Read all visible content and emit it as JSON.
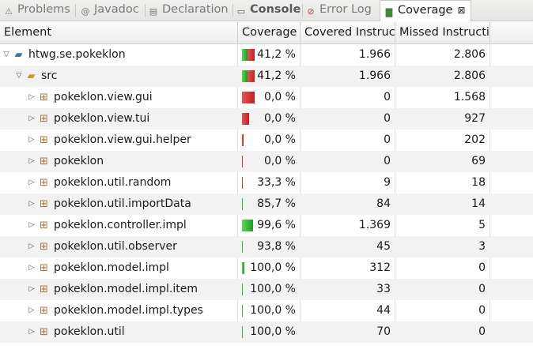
{
  "tabs": [
    {
      "label": "Problems",
      "icon": "problems-icon",
      "glyph": "⚠"
    },
    {
      "label": "Javadoc",
      "icon": "javadoc-icon",
      "glyph": "@"
    },
    {
      "label": "Declaration",
      "icon": "declaration-icon",
      "glyph": "▤"
    },
    {
      "label": "Console",
      "icon": "console-icon",
      "glyph": "▭"
    },
    {
      "label": "Error Log",
      "icon": "error-log-icon",
      "glyph": "⊘"
    },
    {
      "label": "Coverage",
      "icon": "coverage-icon",
      "glyph": "▇"
    }
  ],
  "active_tab_close": "⊠",
  "columns": [
    "Element",
    "Coverage",
    "Covered Instruc",
    "Missed Instructi"
  ],
  "rows": [
    {
      "name": "htwg.se.pokeklon",
      "kind": "project",
      "expanded": true,
      "coverage": "41,2 %",
      "ratio": 0.412,
      "covered": "1.966",
      "missed": "2.806"
    },
    {
      "name": "src",
      "kind": "folder",
      "expanded": true,
      "coverage": "41,2 %",
      "ratio": 0.412,
      "covered": "1.966",
      "missed": "2.806"
    },
    {
      "name": "pokeklon.view.gui",
      "kind": "package",
      "coverage": "0,0 %",
      "ratio": 0.0,
      "covered": "0",
      "missed": "1.568"
    },
    {
      "name": "pokeklon.view.tui",
      "kind": "package",
      "coverage": "0,0 %",
      "ratio": 0.0,
      "covered": "0",
      "missed": "927"
    },
    {
      "name": "pokeklon.view.gui.helper",
      "kind": "package",
      "coverage": "0,0 %",
      "ratio": 0.0,
      "covered": "0",
      "missed": "202"
    },
    {
      "name": "pokeklon",
      "kind": "package",
      "coverage": "0,0 %",
      "ratio": 0.0,
      "covered": "0",
      "missed": "69"
    },
    {
      "name": "pokeklon.util.random",
      "kind": "package",
      "coverage": "33,3 %",
      "ratio": 0.333,
      "covered": "9",
      "missed": "18"
    },
    {
      "name": "pokeklon.util.importData",
      "kind": "package",
      "coverage": "85,7 %",
      "ratio": 0.857,
      "covered": "84",
      "missed": "14"
    },
    {
      "name": "pokeklon.controller.impl",
      "kind": "package",
      "coverage": "99,6 %",
      "ratio": 0.996,
      "covered": "1.369",
      "missed": "5"
    },
    {
      "name": "pokeklon.util.observer",
      "kind": "package",
      "coverage": "93,8 %",
      "ratio": 0.938,
      "covered": "45",
      "missed": "3"
    },
    {
      "name": "pokeklon.model.impl",
      "kind": "package",
      "coverage": "100,0 %",
      "ratio": 1.0,
      "covered": "312",
      "missed": "0"
    },
    {
      "name": "pokeklon.model.impl.item",
      "kind": "package",
      "coverage": "100,0 %",
      "ratio": 1.0,
      "covered": "33",
      "missed": "0"
    },
    {
      "name": "pokeklon.model.impl.types",
      "kind": "package",
      "coverage": "100,0 %",
      "ratio": 1.0,
      "covered": "44",
      "missed": "0"
    },
    {
      "name": "pokeklon.util",
      "kind": "package",
      "coverage": "100,0 %",
      "ratio": 1.0,
      "covered": "70",
      "missed": "0"
    }
  ],
  "colors": {
    "covered": "#1e9c1e",
    "missed": "#c41f1f"
  }
}
